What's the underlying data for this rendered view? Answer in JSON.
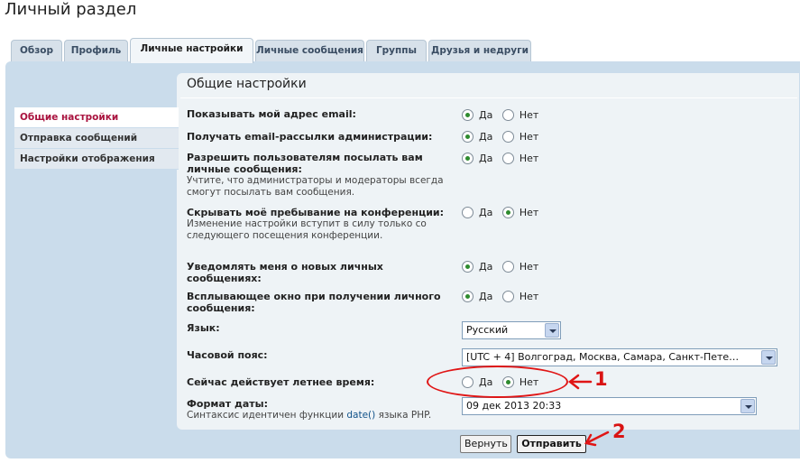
{
  "page_title": "Личный раздел",
  "tabs": [
    {
      "label": "Обзор"
    },
    {
      "label": "Профиль"
    },
    {
      "label": "Личные настройки"
    },
    {
      "label": "Личные сообщения"
    },
    {
      "label": "Группы"
    },
    {
      "label": "Друзья и недруги"
    }
  ],
  "side_menu": [
    {
      "label": "Общие настройки"
    },
    {
      "label": "Отправка сообщений"
    },
    {
      "label": "Настройки отображения"
    }
  ],
  "section_title": "Общие настройки",
  "yes_label": "Да",
  "no_label": "Нет",
  "rows": [
    {
      "label": "Показывать мой адрес email:",
      "note": "",
      "value": "Да"
    },
    {
      "label": "Получать email-рассылки администрации:",
      "note": "",
      "value": "Да"
    },
    {
      "label": "Разрешить пользователям посылать вам личные сообщения:",
      "note": "Учтите, что администраторы и модераторы всегда смогут посылать вам сообщения.",
      "value": "Да"
    },
    {
      "label": "Скрывать моё пребывание на конференции:",
      "note": "Изменение настройки вступит в силу только со следующего посещения конференции.",
      "value": "Нет"
    },
    {
      "label": "Уведомлять меня о новых личных сообщениях:",
      "note": "",
      "value": "Да"
    },
    {
      "label": "Всплывающее окно при получении личного сообщения:",
      "note": "",
      "value": "Да"
    }
  ],
  "language": {
    "label": "Язык:",
    "value": "Русский"
  },
  "timezone": {
    "label": "Часовой пояс:",
    "value": "[UTC + 4] Волгоград, Москва, Самара, Санкт-Пете…"
  },
  "dst": {
    "label": "Сейчас действует летнее время:",
    "value": "Нет"
  },
  "date_format": {
    "label": "Формат даты:",
    "note_prefix": "Синтаксис идентичен функции ",
    "note_link": "date()",
    "note_suffix": " языка PHP.",
    "value": "09 дек 2013 20:33"
  },
  "buttons": {
    "reset": "Вернуть",
    "submit": "Отправить"
  },
  "annotations": {
    "one": "1",
    "two": "2",
    "color": "#e01515"
  }
}
